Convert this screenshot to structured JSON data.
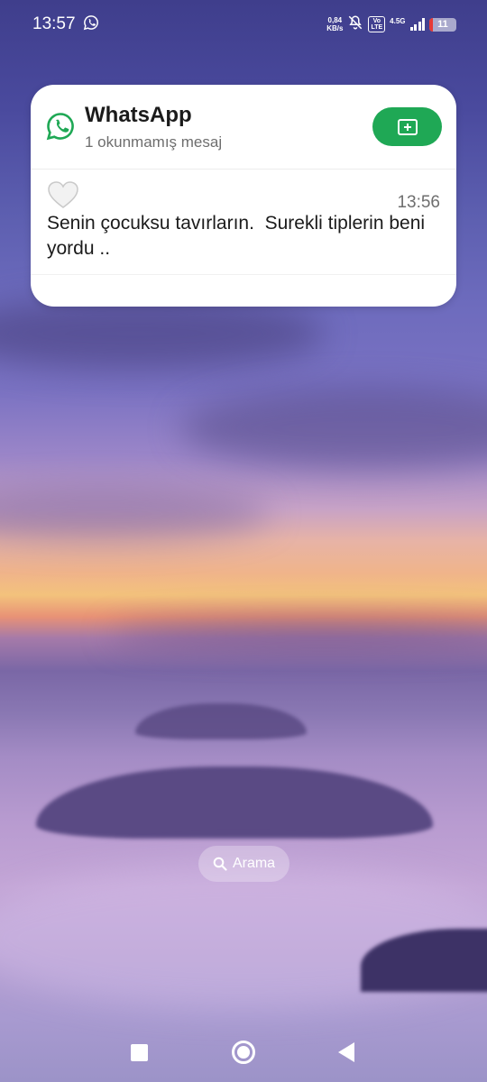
{
  "status_bar": {
    "time": "13:57",
    "net_speed_value": "0,84",
    "net_speed_unit": "KB/s",
    "volte_top": "Vo",
    "volte_bottom": "LTE",
    "network_type": "4.5G",
    "battery_level": "11",
    "icons": [
      "whatsapp-icon",
      "mute-bell-icon",
      "volte-icon",
      "signal-icon",
      "battery-icon"
    ]
  },
  "notification": {
    "app_name": "WhatsApp",
    "subtitle": "1 okunmamış mesaj",
    "accent_color": "#1fa855",
    "message": {
      "time": "13:56",
      "text": "Senin çocuksu tavırların.  Surekli tiplerin beni yordu ..",
      "avatar_icon": "white-heart-icon"
    },
    "bubble_button_icon": "open-bubble-icon"
  },
  "search": {
    "label": "Arama",
    "icon": "search-icon"
  },
  "nav": {
    "icons": [
      "recents-icon",
      "home-icon",
      "back-icon"
    ]
  }
}
